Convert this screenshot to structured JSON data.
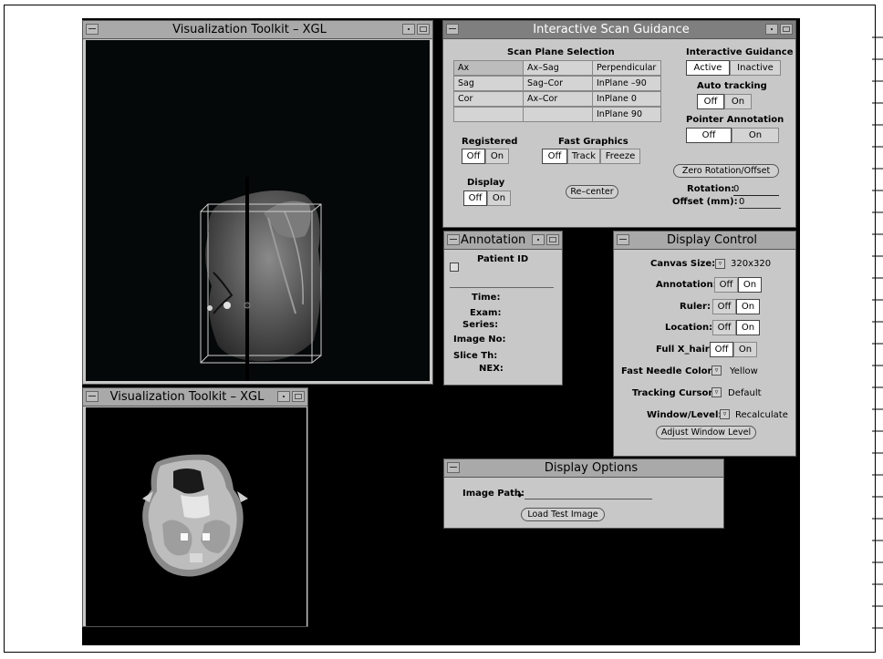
{
  "viz3d": {
    "title": "Visualization Toolkit – XGL"
  },
  "viz2d": {
    "title": "Visualization Toolkit – XGL"
  },
  "scan": {
    "title": "Interactive Scan Guidance",
    "plane_heading": "Scan Plane Selection",
    "col1": [
      "Ax",
      "Sag",
      "Cor",
      ""
    ],
    "col2": [
      "Ax–Sag",
      "Sag–Cor",
      "Ax–Cor",
      ""
    ],
    "col3": [
      "Perpendicular",
      "InPlane –90",
      "InPlane 0",
      "InPlane 90"
    ],
    "guidance_heading": "Interactive Guidance",
    "guidance_active": "Active",
    "guidance_inactive": "Inactive",
    "autotrack_heading": "Auto tracking",
    "autotrack_off": "Off",
    "autotrack_on": "On",
    "pointer_heading": "Pointer Annotation",
    "pointer_off": "Off",
    "pointer_on": "On",
    "registered_heading": "Registered",
    "registered_off": "Off",
    "registered_on": "On",
    "fastgfx_heading": "Fast Graphics",
    "fastgfx_off": "Off",
    "fastgfx_track": "Track",
    "fastgfx_freeze": "Freeze",
    "display_heading": "Display",
    "display_off": "Off",
    "display_on": "On",
    "zero_button": "Zero Rotation/Offset",
    "recenter_button": "Re–center",
    "rotation_label": "Rotation:",
    "rotation_value": "0",
    "offset_label": "Offset (mm):",
    "offset_value": "0"
  },
  "annotation": {
    "title": "Annotation",
    "patient_id": "Patient ID",
    "fields": [
      "Time:",
      "Exam:",
      "Series:",
      "Image No:",
      "Slice Th:",
      "NEX:"
    ]
  },
  "display_control": {
    "title": "Display Control",
    "canvas_label": "Canvas Size:",
    "canvas_value": "320x320",
    "annotation_label": "Annotation:",
    "ruler_label": "Ruler:",
    "location_label": "Location:",
    "xhair_label": "Full X_hair:",
    "off": "Off",
    "on": "On",
    "needle_label": "Fast Needle Color:",
    "needle_value": "Yellow",
    "cursor_label": "Tracking Cursor:",
    "cursor_value": "Default",
    "wl_label": "Window/Level:",
    "wl_value": "Recalculate",
    "adjust_button": "Adjust Window Level"
  },
  "display_options": {
    "title": "Display Options",
    "path_label": "Image Path:",
    "load_button": "Load Test Image"
  }
}
